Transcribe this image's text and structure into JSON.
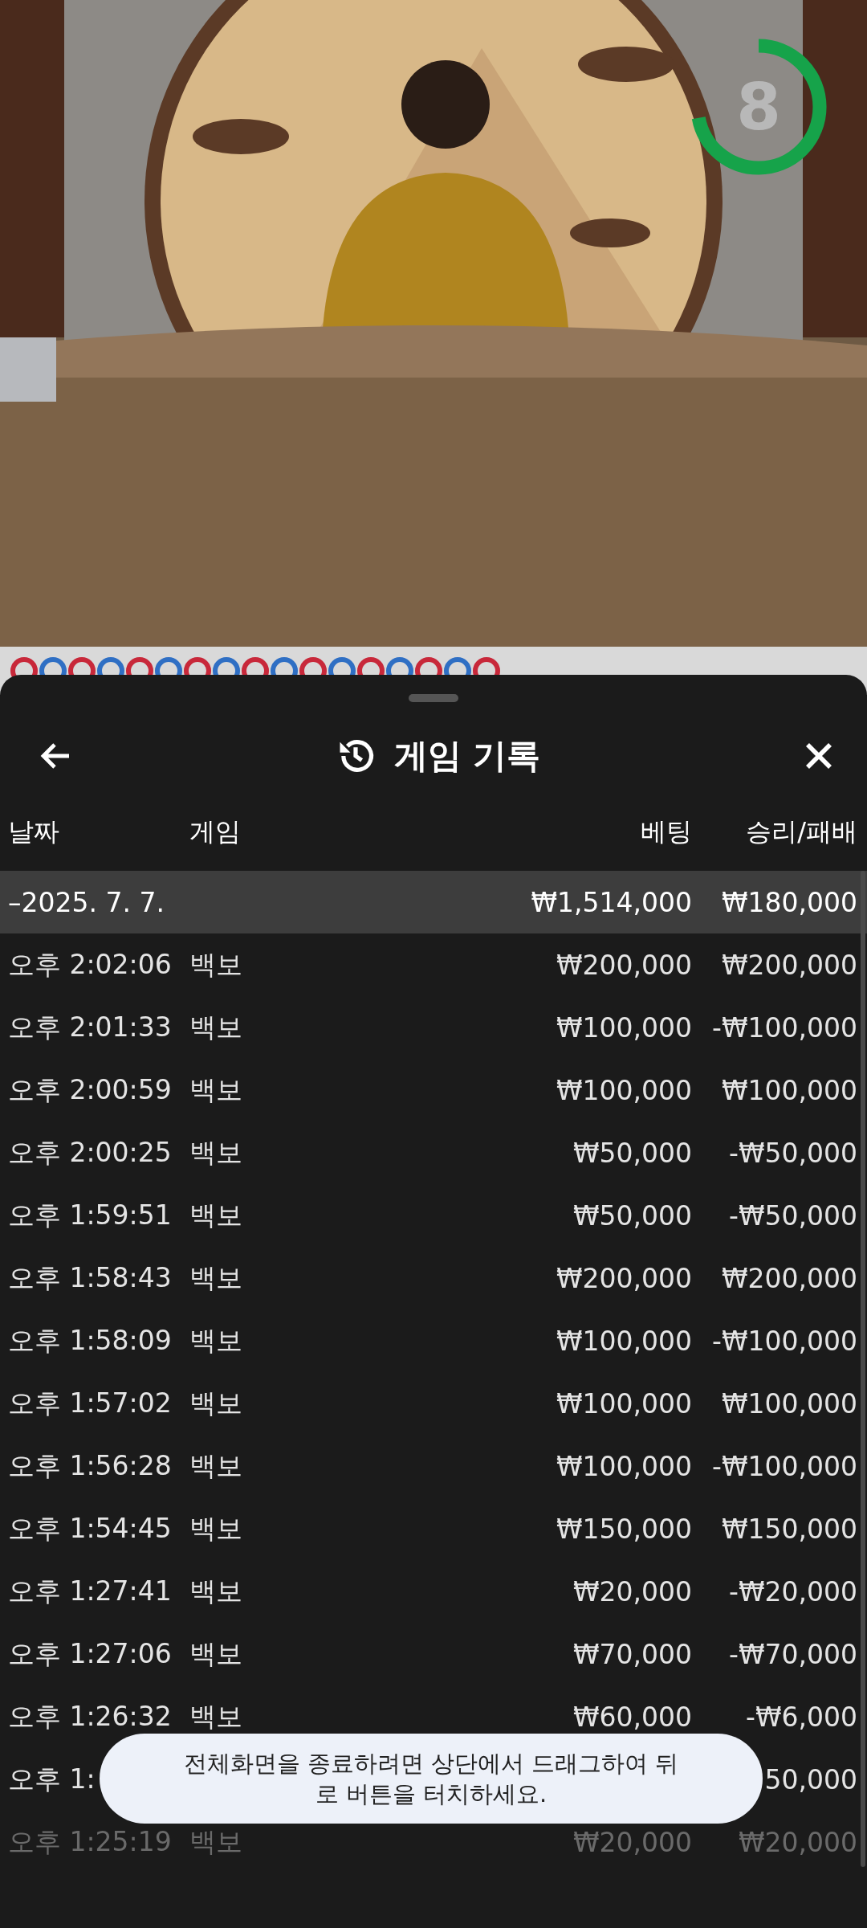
{
  "video": {
    "timer": {
      "text": "8",
      "level": 0.72
    }
  },
  "road": [
    {
      "color": "#c8283a"
    },
    {
      "color": "#2f6fc4"
    },
    {
      "color": "#c8283a"
    },
    {
      "color": "#2f6fc4"
    },
    {
      "color": "#c8283a"
    },
    {
      "color": "#2f6fc4"
    },
    {
      "color": "#c8283a"
    },
    {
      "color": "#2f6fc4"
    },
    {
      "color": "#c8283a"
    },
    {
      "color": "#2f6fc4"
    },
    {
      "color": "#c8283a"
    },
    {
      "color": "#2f6fc4"
    },
    {
      "color": "#c8283a"
    },
    {
      "color": "#2f6fc4"
    },
    {
      "color": "#c8283a"
    },
    {
      "color": "#2f6fc4"
    },
    {
      "color": "#c8283a"
    }
  ],
  "sheet": {
    "title": "게임 기록",
    "columns": [
      "날짜",
      "게임",
      "베팅",
      "승리/패배"
    ],
    "summary": {
      "date": "–2025. 7. 7.",
      "bet": "₩1,514,000",
      "result": "₩180,000"
    },
    "rows": [
      {
        "time": "오후 2:02:06",
        "game": "백보",
        "bet": "₩200,000",
        "result": "₩200,000"
      },
      {
        "time": "오후 2:01:33",
        "game": "백보",
        "bet": "₩100,000",
        "result": "-₩100,000"
      },
      {
        "time": "오후 2:00:59",
        "game": "백보",
        "bet": "₩100,000",
        "result": "₩100,000"
      },
      {
        "time": "오후 2:00:25",
        "game": "백보",
        "bet": "₩50,000",
        "result": "-₩50,000"
      },
      {
        "time": "오후 1:59:51",
        "game": "백보",
        "bet": "₩50,000",
        "result": "-₩50,000"
      },
      {
        "time": "오후 1:58:43",
        "game": "백보",
        "bet": "₩200,000",
        "result": "₩200,000"
      },
      {
        "time": "오후 1:58:09",
        "game": "백보",
        "bet": "₩100,000",
        "result": "-₩100,000"
      },
      {
        "time": "오후 1:57:02",
        "game": "백보",
        "bet": "₩100,000",
        "result": "₩100,000"
      },
      {
        "time": "오후 1:56:28",
        "game": "백보",
        "bet": "₩100,000",
        "result": "-₩100,000"
      },
      {
        "time": "오후 1:54:45",
        "game": "백보",
        "bet": "₩150,000",
        "result": "₩150,000"
      },
      {
        "time": "오후 1:27:41",
        "game": "백보",
        "bet": "₩20,000",
        "result": "-₩20,000"
      },
      {
        "time": "오후 1:27:06",
        "game": "백보",
        "bet": "₩70,000",
        "result": "-₩70,000"
      },
      {
        "time": "오후 1:26:32",
        "game": "백보",
        "bet": "₩60,000",
        "result": "-₩6,000"
      },
      {
        "time": "오후 1:",
        "result": "50,000"
      },
      {
        "time": "오후 1:25:19",
        "game": "백보",
        "bet": "₩20,000",
        "result": "₩20,000",
        "faded": true
      }
    ]
  },
  "toast": "전체화면을 종료하려면 상단에서 드래그하여 뒤로 버튼을 터치하세요."
}
